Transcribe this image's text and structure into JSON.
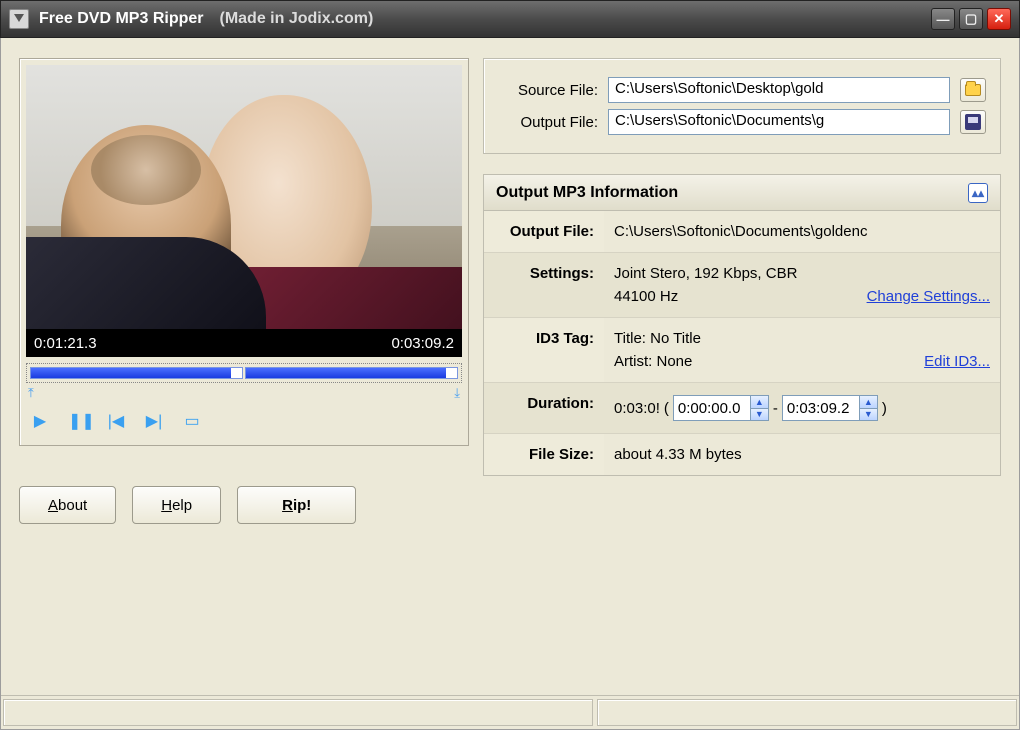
{
  "titlebar": {
    "title": "Free DVD MP3 Ripper",
    "subtitle": "(Made in Jodix.com)"
  },
  "player": {
    "current_time": "0:01:21.3",
    "total_time": "0:03:09.2",
    "progress_left_pct": 95,
    "progress_right_pct": 95
  },
  "buttons": {
    "about": "About",
    "help": "Help",
    "rip": "Rip!"
  },
  "files": {
    "source_label": "Source File:",
    "source_value": "C:\\Users\\Softonic\\Desktop\\gold",
    "output_label": "Output File:",
    "output_value": "C:\\Users\\Softonic\\Documents\\g"
  },
  "info_panel": {
    "title": "Output MP3 Information",
    "rows": {
      "output_file": {
        "key": "Output File:",
        "value": "C:\\Users\\Softonic\\Documents\\goldenc"
      },
      "settings": {
        "key": "Settings:",
        "line1": "Joint Stero, 192 Kbps, CBR",
        "line2": "44100 Hz",
        "link": "Change Settings..."
      },
      "id3": {
        "key": "ID3 Tag:",
        "line1": "Title: No Title",
        "line2": "Artist: None",
        "link": "Edit ID3..."
      },
      "duration": {
        "key": "Duration:",
        "total": "0:03:0!",
        "from": "0:00:00.0",
        "to": "0:03:09.2"
      },
      "filesize": {
        "key": "File Size:",
        "value": "about 4.33 M bytes"
      }
    }
  }
}
